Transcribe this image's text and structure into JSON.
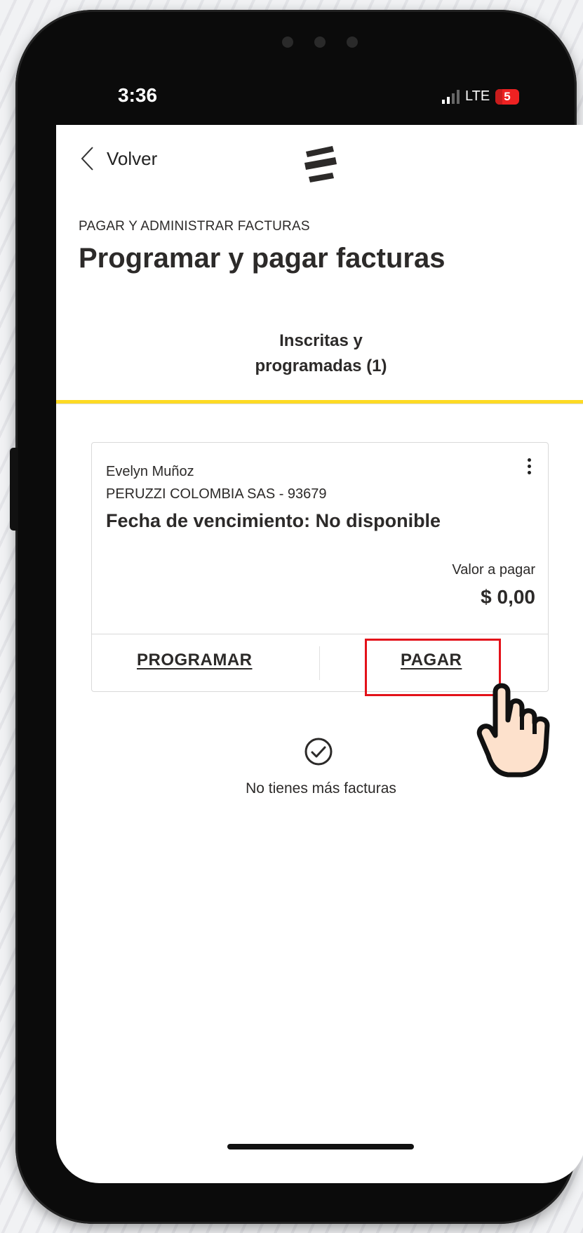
{
  "status_bar": {
    "time": "3:36",
    "network": "LTE",
    "battery": "5"
  },
  "nav": {
    "back_label": "Volver",
    "logo_icon": "bancolombia-logo"
  },
  "header": {
    "section": "PAGAR Y ADMINISTRAR FACTURAS",
    "title": "Programar y pagar facturas"
  },
  "tabs": [
    {
      "label_line1": "Inscritas y",
      "label_line2": "programadas (1)",
      "active": true
    }
  ],
  "bill": {
    "name": "Evelyn Muñoz",
    "company": "PERUZZI COLOMBIA SAS - 93679",
    "due": "Fecha de vencimiento: No disponible",
    "amount_label": "Valor a pagar",
    "amount": "$ 0,00",
    "program_label": "PROGRAMAR",
    "pay_label": "PAGAR"
  },
  "empty_state": {
    "message": "No tienes más facturas",
    "icon": "check-circle-icon"
  },
  "colors": {
    "accent": "#fdda24",
    "highlight": "#e3121a",
    "text": "#2c2a29"
  }
}
